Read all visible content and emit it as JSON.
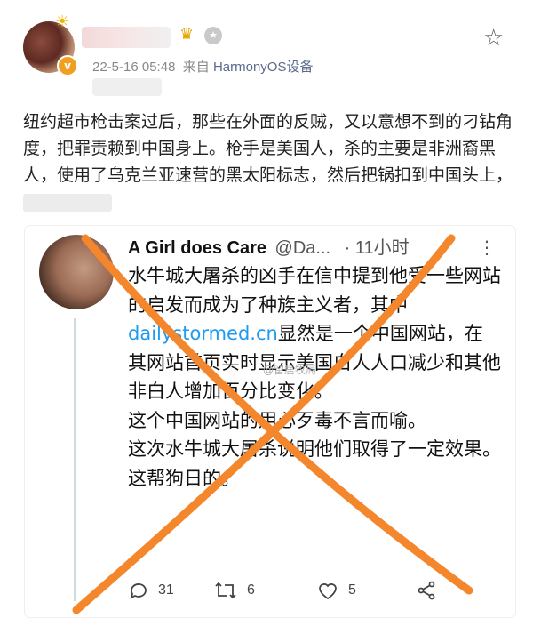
{
  "post": {
    "timestamp": "22-5-16 05:48",
    "source_prefix": "来自",
    "source": "HarmonyOS设备",
    "text": "纽约超市枪击案过后，那些在外面的反贼，又以意想不到的刁钻角度，把罪责赖到中国身上。枪手是美国人，杀的主要是非洲裔黑人，使用了乌克兰亚速营的黑太阳标志，然后把锅扣到中国头上，"
  },
  "embedded_tweet": {
    "author_name": "A Girl does Care",
    "handle": "@Da...",
    "time": "· 11小时",
    "text_before_link": "水牛城大屠杀的凶手在信中提到他受一些网站的启发而成为了种族主义者，其中",
    "link": "dailystormed.cn",
    "text_after_link": "显然是一个中国网站，在其网站首页实时显示美国白人人口减少和其他非白人增加百分比变化。",
    "line2": "这个中国网站的用心歹毒不言而喻。",
    "line3": "这次水牛城大屠杀说明他们取得了一定效果。",
    "line4": "这帮狗日的。",
    "replies": "31",
    "retweets": "6",
    "likes": "5"
  },
  "watermark": "@留居牧局",
  "colors": {
    "link": "#1d9bf0",
    "overlay_x": "#f4862c",
    "source": "#5b6b8c"
  },
  "icons": [
    "crown-icon",
    "medal-icon",
    "star-icon",
    "more-icon",
    "reply-icon",
    "retweet-icon",
    "like-icon",
    "share-icon"
  ]
}
